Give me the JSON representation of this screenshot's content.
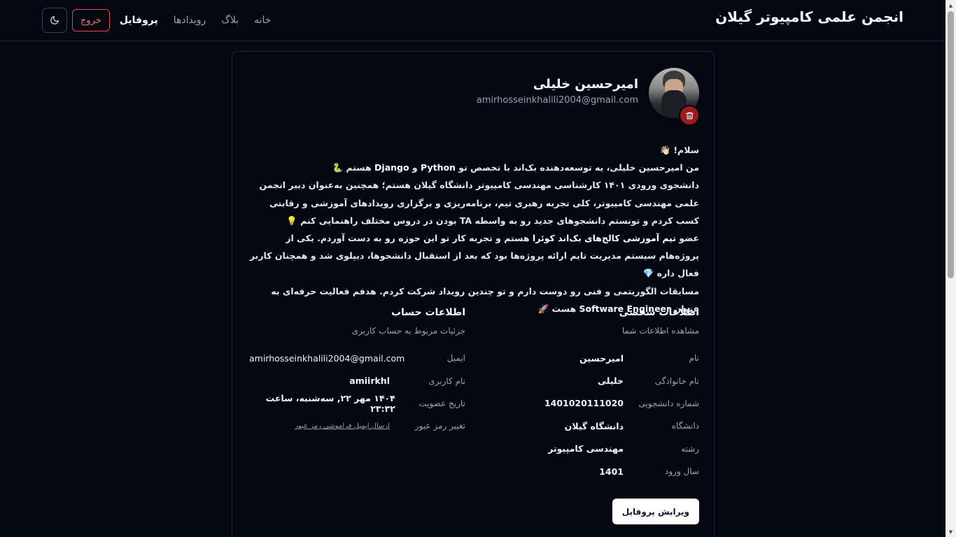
{
  "header": {
    "site_title": "انجمن علمی کامپیوتر گیلان",
    "nav": {
      "home": "خانه",
      "blog": "بلاگ",
      "events": "رویدادها",
      "profile": "پروفایل",
      "logout": "خروج",
      "theme_icon": "moon-icon"
    }
  },
  "profile": {
    "name": "امیرحسین خلیلی",
    "email": "amirhosseinkhalili2004@gmail.com",
    "delete_icon": "trash-icon",
    "bio": {
      "l1": "سلام! 👋🏻",
      "l2_a": "من امیرحسین خلیلی، یه توسعه‌دهنده بک‌اند با تخصص تو ",
      "l2_python": "Python",
      "l2_and": " و ",
      "l2_django": "Django",
      "l2_b": " هستم 🐍",
      "l3": "دانشجوی ورودی ۱۴۰۱ کارشناسی مهندسی کامپیوتر دانشگاه گیلان هستم؛ همچنین به‌عنوان دبیر انجمن علمی مهندسی کامپیوتر، کلی تجربه رهبری تیم، برنامه‌ریزی و برگزاری رویدادهای آموزشی و رقابتی کسب کردم و تونستم دانشجوهای جدید رو به واسطه TA بودن در دروس مختلف راهنمایی کنم 💡",
      "l4_a": "عضو ",
      "l4_b": "تیم آموزشی کالج‌های بک‌اند کوئرا",
      "l4_c": " هستم و تجربه کار تو این حوزه رو به دست آوردم. یکی از پروژه‌هام سیستم مدیریت تایم ارائه پروژه‌ها بود که بعد از استقبال دانشجوها، دیپلوی شد و همچنان کاربر فعال داره 💎",
      "l5_a": "مسابقات الگوریتمی و فنی رو دوست دارم و تو چندین رویداد شرکت کردم. هدفم فعالیت حرفه‌ای به عنوان ",
      "l5_b": "Software Engineer",
      "l5_c": " هست 🚀"
    },
    "personal": {
      "title": "اطلاعات شخصی",
      "subtitle": "مشاهده اطلاعات شما",
      "rows": [
        {
          "label": "نام",
          "value": "امیرحسین"
        },
        {
          "label": "نام خانوادگی",
          "value": "خلیلی"
        },
        {
          "label": "شماره دانشجویی",
          "value": "1401020111020"
        },
        {
          "label": "دانشگاه",
          "value": "دانشگاه گیلان"
        },
        {
          "label": "رشته",
          "value": "مهندسی کامپیوتر"
        },
        {
          "label": "سال ورود",
          "value": "1401"
        }
      ]
    },
    "account": {
      "title": "اطلاعات حساب",
      "subtitle": "جزئیات مربوط به حساب کاربری",
      "rows": [
        {
          "label": "ایمیل",
          "value": "amirhosseinkhalili2004@gmail.com"
        },
        {
          "label": "نام کاربری",
          "value": "amiirkhl"
        },
        {
          "label": "تاریخ عضویت",
          "value": "۱۴۰۴ مهر ۲۲, سه‌شنبه، ساعت ۲۳:۳۲"
        },
        {
          "label": "تغییر رمز عبور",
          "value": "ارسال ایمیل فراموشی رمز عبور"
        }
      ]
    },
    "edit_button": "ویرایش پروفایل"
  }
}
